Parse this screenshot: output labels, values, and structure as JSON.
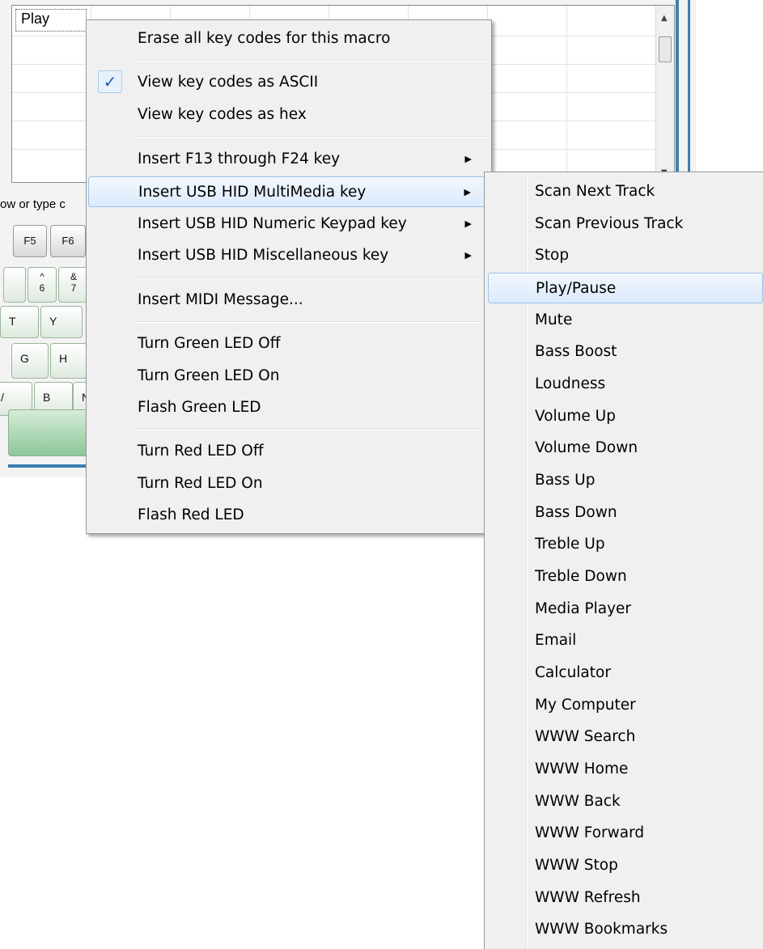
{
  "grid": {
    "first_cell": "Play"
  },
  "hint_text": "ow or type c",
  "keyboard": {
    "fkeys": [
      "F5",
      "F6"
    ],
    "num_keys": [
      {
        "top": "^",
        "bottom": "6"
      },
      {
        "top": "&",
        "bottom": "7"
      }
    ],
    "row_q": [
      "T",
      "Y"
    ],
    "row_a": [
      "G",
      "H"
    ],
    "row_z": [
      "/",
      "B",
      "N"
    ]
  },
  "context_menu": {
    "items": [
      {
        "label": "Erase all key codes for this macro"
      },
      {
        "label": "View key codes as ASCII",
        "checked": true
      },
      {
        "label": "View key codes as hex"
      },
      {
        "label": "Insert F13 through F24 key",
        "submenu": true
      },
      {
        "label": "Insert USB HID MultiMedia key",
        "submenu": true,
        "highlighted": true
      },
      {
        "label": "Insert USB HID Numeric Keypad key",
        "submenu": true
      },
      {
        "label": "Insert USB HID Miscellaneous key",
        "submenu": true
      },
      {
        "label": "Insert MIDI Message..."
      },
      {
        "label": "Turn Green LED Off"
      },
      {
        "label": "Turn Green LED On"
      },
      {
        "label": "Flash Green LED"
      },
      {
        "label": "Turn Red LED Off"
      },
      {
        "label": "Turn Red LED On"
      },
      {
        "label": "Flash Red LED"
      }
    ],
    "checkmark_glyph": "✓",
    "arrow_glyph": "▶"
  },
  "multimedia_submenu": {
    "items": [
      "Scan Next Track",
      "Scan Previous Track",
      "Stop",
      "Play/Pause",
      "Mute",
      "Bass Boost",
      "Loudness",
      "Volume Up",
      "Volume Down",
      "Bass Up",
      "Bass Down",
      "Treble Up",
      "Treble Down",
      "Media Player",
      "Email",
      "Calculator",
      "My Computer",
      "WWW Search",
      "WWW Home",
      "WWW Back",
      "WWW Forward",
      "WWW Stop",
      "WWW Refresh",
      "WWW Bookmarks"
    ],
    "highlighted_item": "Play/Pause"
  },
  "colors": {
    "menu_bg": "#f0f0f0",
    "highlight_border": "#9dc1ea",
    "window_accent": "#3c7fb1"
  }
}
